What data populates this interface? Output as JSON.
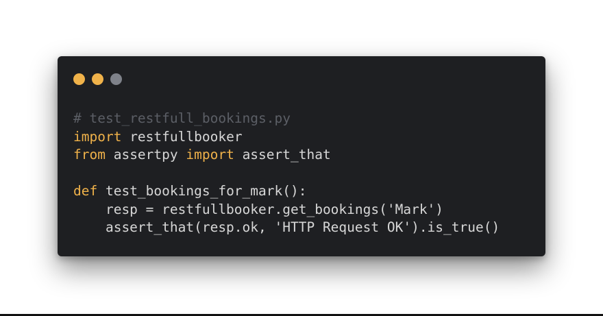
{
  "window": {
    "controls": [
      {
        "name": "close",
        "color": "#f0b24a"
      },
      {
        "name": "minimize",
        "color": "#f0b24a"
      },
      {
        "name": "zoom",
        "color": "#7f828a"
      }
    ]
  },
  "code": {
    "language": "python",
    "colors": {
      "background": "#1e1f22",
      "plain": "#d7d7d7",
      "keyword": "#f0b24a",
      "comment": "#5c5f66"
    },
    "lines": [
      [
        {
          "type": "comment",
          "text": "# test_restfull_bookings.py"
        }
      ],
      [
        {
          "type": "keyword",
          "text": "import"
        },
        {
          "type": "plain",
          "text": " restfullbooker"
        }
      ],
      [
        {
          "type": "keyword",
          "text": "from"
        },
        {
          "type": "plain",
          "text": " assertpy "
        },
        {
          "type": "keyword",
          "text": "import"
        },
        {
          "type": "plain",
          "text": " assert_that"
        }
      ],
      [
        {
          "type": "plain",
          "text": ""
        }
      ],
      [
        {
          "type": "keyword",
          "text": "def"
        },
        {
          "type": "plain",
          "text": " test_bookings_for_mark():"
        }
      ],
      [
        {
          "type": "plain",
          "text": "    resp = restfullbooker.get_bookings('Mark')"
        }
      ],
      [
        {
          "type": "plain",
          "text": "    assert_that(resp.ok, 'HTTP Request OK').is_true()"
        }
      ]
    ]
  }
}
